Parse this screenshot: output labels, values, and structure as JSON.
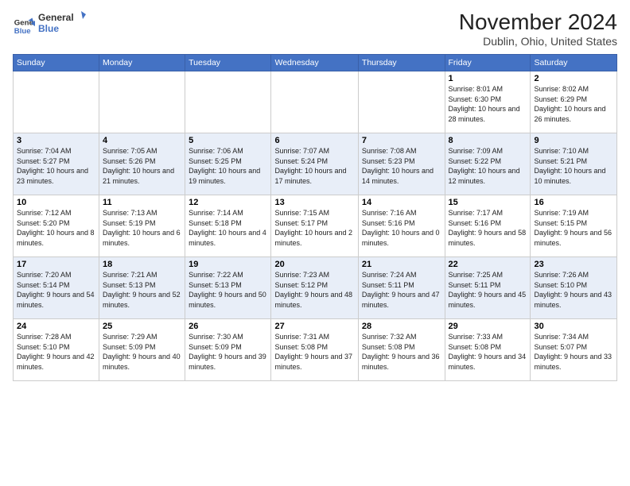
{
  "header": {
    "logo_line1": "General",
    "logo_line2": "Blue",
    "month_title": "November 2024",
    "location": "Dublin, Ohio, United States"
  },
  "weekdays": [
    "Sunday",
    "Monday",
    "Tuesday",
    "Wednesday",
    "Thursday",
    "Friday",
    "Saturday"
  ],
  "weeks": [
    [
      {
        "day": "",
        "info": ""
      },
      {
        "day": "",
        "info": ""
      },
      {
        "day": "",
        "info": ""
      },
      {
        "day": "",
        "info": ""
      },
      {
        "day": "",
        "info": ""
      },
      {
        "day": "1",
        "info": "Sunrise: 8:01 AM\nSunset: 6:30 PM\nDaylight: 10 hours and 28 minutes."
      },
      {
        "day": "2",
        "info": "Sunrise: 8:02 AM\nSunset: 6:29 PM\nDaylight: 10 hours and 26 minutes."
      }
    ],
    [
      {
        "day": "3",
        "info": "Sunrise: 7:04 AM\nSunset: 5:27 PM\nDaylight: 10 hours and 23 minutes."
      },
      {
        "day": "4",
        "info": "Sunrise: 7:05 AM\nSunset: 5:26 PM\nDaylight: 10 hours and 21 minutes."
      },
      {
        "day": "5",
        "info": "Sunrise: 7:06 AM\nSunset: 5:25 PM\nDaylight: 10 hours and 19 minutes."
      },
      {
        "day": "6",
        "info": "Sunrise: 7:07 AM\nSunset: 5:24 PM\nDaylight: 10 hours and 17 minutes."
      },
      {
        "day": "7",
        "info": "Sunrise: 7:08 AM\nSunset: 5:23 PM\nDaylight: 10 hours and 14 minutes."
      },
      {
        "day": "8",
        "info": "Sunrise: 7:09 AM\nSunset: 5:22 PM\nDaylight: 10 hours and 12 minutes."
      },
      {
        "day": "9",
        "info": "Sunrise: 7:10 AM\nSunset: 5:21 PM\nDaylight: 10 hours and 10 minutes."
      }
    ],
    [
      {
        "day": "10",
        "info": "Sunrise: 7:12 AM\nSunset: 5:20 PM\nDaylight: 10 hours and 8 minutes."
      },
      {
        "day": "11",
        "info": "Sunrise: 7:13 AM\nSunset: 5:19 PM\nDaylight: 10 hours and 6 minutes."
      },
      {
        "day": "12",
        "info": "Sunrise: 7:14 AM\nSunset: 5:18 PM\nDaylight: 10 hours and 4 minutes."
      },
      {
        "day": "13",
        "info": "Sunrise: 7:15 AM\nSunset: 5:17 PM\nDaylight: 10 hours and 2 minutes."
      },
      {
        "day": "14",
        "info": "Sunrise: 7:16 AM\nSunset: 5:16 PM\nDaylight: 10 hours and 0 minutes."
      },
      {
        "day": "15",
        "info": "Sunrise: 7:17 AM\nSunset: 5:16 PM\nDaylight: 9 hours and 58 minutes."
      },
      {
        "day": "16",
        "info": "Sunrise: 7:19 AM\nSunset: 5:15 PM\nDaylight: 9 hours and 56 minutes."
      }
    ],
    [
      {
        "day": "17",
        "info": "Sunrise: 7:20 AM\nSunset: 5:14 PM\nDaylight: 9 hours and 54 minutes."
      },
      {
        "day": "18",
        "info": "Sunrise: 7:21 AM\nSunset: 5:13 PM\nDaylight: 9 hours and 52 minutes."
      },
      {
        "day": "19",
        "info": "Sunrise: 7:22 AM\nSunset: 5:13 PM\nDaylight: 9 hours and 50 minutes."
      },
      {
        "day": "20",
        "info": "Sunrise: 7:23 AM\nSunset: 5:12 PM\nDaylight: 9 hours and 48 minutes."
      },
      {
        "day": "21",
        "info": "Sunrise: 7:24 AM\nSunset: 5:11 PM\nDaylight: 9 hours and 47 minutes."
      },
      {
        "day": "22",
        "info": "Sunrise: 7:25 AM\nSunset: 5:11 PM\nDaylight: 9 hours and 45 minutes."
      },
      {
        "day": "23",
        "info": "Sunrise: 7:26 AM\nSunset: 5:10 PM\nDaylight: 9 hours and 43 minutes."
      }
    ],
    [
      {
        "day": "24",
        "info": "Sunrise: 7:28 AM\nSunset: 5:10 PM\nDaylight: 9 hours and 42 minutes."
      },
      {
        "day": "25",
        "info": "Sunrise: 7:29 AM\nSunset: 5:09 PM\nDaylight: 9 hours and 40 minutes."
      },
      {
        "day": "26",
        "info": "Sunrise: 7:30 AM\nSunset: 5:09 PM\nDaylight: 9 hours and 39 minutes."
      },
      {
        "day": "27",
        "info": "Sunrise: 7:31 AM\nSunset: 5:08 PM\nDaylight: 9 hours and 37 minutes."
      },
      {
        "day": "28",
        "info": "Sunrise: 7:32 AM\nSunset: 5:08 PM\nDaylight: 9 hours and 36 minutes."
      },
      {
        "day": "29",
        "info": "Sunrise: 7:33 AM\nSunset: 5:08 PM\nDaylight: 9 hours and 34 minutes."
      },
      {
        "day": "30",
        "info": "Sunrise: 7:34 AM\nSunset: 5:07 PM\nDaylight: 9 hours and 33 minutes."
      }
    ]
  ]
}
